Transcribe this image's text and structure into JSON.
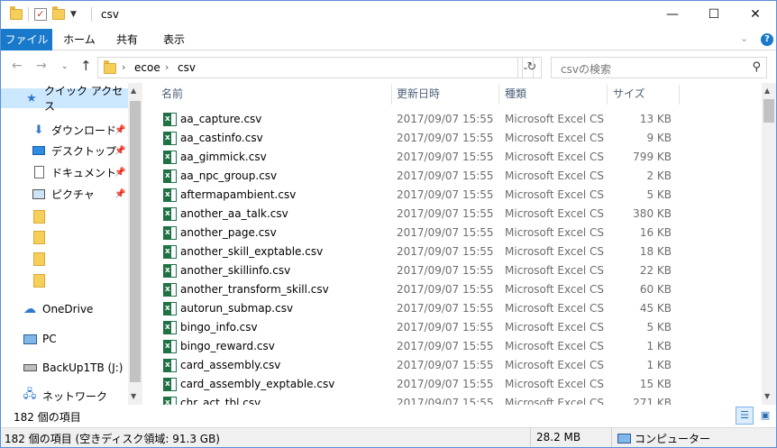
{
  "window": {
    "title": "csv",
    "minimize": "—",
    "maximize": "☐",
    "close": "✕"
  },
  "ribbon": {
    "tabs": [
      "ファイル",
      "ホーム",
      "共有",
      "表示"
    ],
    "collapse": "⌄",
    "help": "?"
  },
  "address": {
    "crumbs": [
      "ecoe",
      "csv"
    ],
    "search_placeholder": "csvの検索"
  },
  "sidebar": {
    "items": [
      {
        "label": "クイック アクセス",
        "icon": "star-icon"
      },
      {
        "label": "ダウンロード",
        "icon": "download-icon"
      },
      {
        "label": "デスクトップ",
        "icon": "desktop-icon"
      },
      {
        "label": "ドキュメント",
        "icon": "document-icon"
      },
      {
        "label": "ピクチャ",
        "icon": "picture-icon"
      },
      {
        "label": "",
        "icon": "folder-icon"
      },
      {
        "label": "",
        "icon": "folder-icon"
      },
      {
        "label": "",
        "icon": "folder-icon"
      },
      {
        "label": "",
        "icon": "folder-icon"
      },
      {
        "label": "OneDrive",
        "icon": "cloud-icon"
      },
      {
        "label": "PC",
        "icon": "pc-icon"
      },
      {
        "label": "BackUp1TB (J:)",
        "icon": "drive-icon"
      },
      {
        "label": "ネットワーク",
        "icon": "network-icon"
      }
    ]
  },
  "columns": {
    "name": "名前",
    "date": "更新日時",
    "type": "種類",
    "size": "サイズ"
  },
  "files": [
    {
      "name": "aa_capture.csv",
      "date": "2017/09/07 15:55",
      "type": "Microsoft Excel CS...",
      "size": "13 KB"
    },
    {
      "name": "aa_castinfo.csv",
      "date": "2017/09/07 15:55",
      "type": "Microsoft Excel CS...",
      "size": "9 KB"
    },
    {
      "name": "aa_gimmick.csv",
      "date": "2017/09/07 15:55",
      "type": "Microsoft Excel CS...",
      "size": "799 KB"
    },
    {
      "name": "aa_npc_group.csv",
      "date": "2017/09/07 15:55",
      "type": "Microsoft Excel CS...",
      "size": "2 KB"
    },
    {
      "name": "aftermapambient.csv",
      "date": "2017/09/07 15:55",
      "type": "Microsoft Excel CS...",
      "size": "5 KB"
    },
    {
      "name": "another_aa_talk.csv",
      "date": "2017/09/07 15:55",
      "type": "Microsoft Excel CS...",
      "size": "380 KB"
    },
    {
      "name": "another_page.csv",
      "date": "2017/09/07 15:55",
      "type": "Microsoft Excel CS...",
      "size": "16 KB"
    },
    {
      "name": "another_skill_exptable.csv",
      "date": "2017/09/07 15:55",
      "type": "Microsoft Excel CS...",
      "size": "18 KB"
    },
    {
      "name": "another_skillinfo.csv",
      "date": "2017/09/07 15:55",
      "type": "Microsoft Excel CS...",
      "size": "22 KB"
    },
    {
      "name": "another_transform_skill.csv",
      "date": "2017/09/07 15:55",
      "type": "Microsoft Excel CS...",
      "size": "60 KB"
    },
    {
      "name": "autorun_submap.csv",
      "date": "2017/09/07 15:55",
      "type": "Microsoft Excel CS...",
      "size": "45 KB"
    },
    {
      "name": "bingo_info.csv",
      "date": "2017/09/07 15:55",
      "type": "Microsoft Excel CS...",
      "size": "5 KB"
    },
    {
      "name": "bingo_reward.csv",
      "date": "2017/09/07 15:55",
      "type": "Microsoft Excel CS...",
      "size": "1 KB"
    },
    {
      "name": "card_assembly.csv",
      "date": "2017/09/07 15:55",
      "type": "Microsoft Excel CS...",
      "size": "1 KB"
    },
    {
      "name": "card_assembly_exptable.csv",
      "date": "2017/09/07 15:55",
      "type": "Microsoft Excel CS...",
      "size": "15 KB"
    },
    {
      "name": "chr_act_tbl.csv",
      "date": "2017/09/07 15:55",
      "type": "Microsoft Excel CS...",
      "size": "271 KB"
    }
  ],
  "status": {
    "item_count": "182 個の項目",
    "summary": "182 個の項目 (空きディスク領域: 91.3 GB)",
    "size": "28.2 MB",
    "location": "コンピューター"
  }
}
